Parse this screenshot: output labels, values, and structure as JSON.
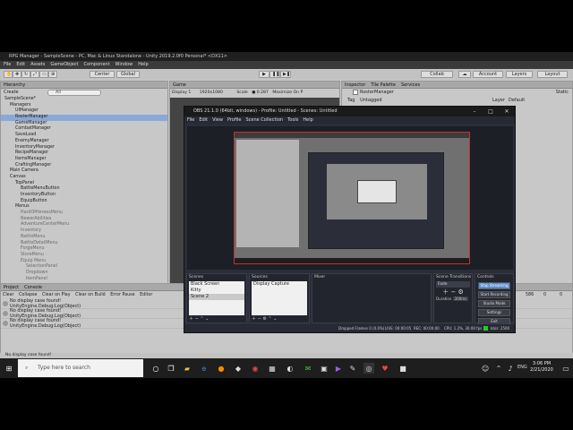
{
  "unity": {
    "title": "RPG Manager - SampleScene - PC, Mac & Linux Standalone - Unity 2019.2.0f0 Personal* <DX11>",
    "menu": [
      "File",
      "Edit",
      "Assets",
      "GameObject",
      "Component",
      "Window",
      "Help"
    ],
    "toolbar": {
      "pivot": "Center",
      "space": "Global",
      "collab": "Collab",
      "account": "Account",
      "layers": "Layers",
      "layout": "Layout"
    },
    "hierarchy_tab": "Hierarchy",
    "hierarchy_create": "Create",
    "hierarchy_search": "All",
    "hierarchy": [
      {
        "label": "SampleScene*",
        "indent": 0,
        "sel": false,
        "dim": false
      },
      {
        "label": "Managers",
        "indent": 1,
        "sel": false,
        "dim": false
      },
      {
        "label": "UIManager",
        "indent": 2,
        "sel": false,
        "dim": false
      },
      {
        "label": "RosterManager",
        "indent": 2,
        "sel": true,
        "dim": false
      },
      {
        "label": "GameManager",
        "indent": 2,
        "sel": false,
        "dim": false
      },
      {
        "label": "CombatManager",
        "indent": 2,
        "sel": false,
        "dim": false
      },
      {
        "label": "SaveLoad",
        "indent": 2,
        "sel": false,
        "dim": false
      },
      {
        "label": "EnemyManager",
        "indent": 2,
        "sel": false,
        "dim": false
      },
      {
        "label": "InventoryManager",
        "indent": 2,
        "sel": false,
        "dim": false
      },
      {
        "label": "RecipeManager",
        "indent": 2,
        "sel": false,
        "dim": false
      },
      {
        "label": "ItemsManager",
        "indent": 2,
        "sel": false,
        "dim": false
      },
      {
        "label": "CraftingManager",
        "indent": 2,
        "sel": false,
        "dim": false
      },
      {
        "label": "Main Camera",
        "indent": 1,
        "sel": false,
        "dim": false
      },
      {
        "label": "Canvas",
        "indent": 1,
        "sel": false,
        "dim": false
      },
      {
        "label": "TopPanel",
        "indent": 2,
        "sel": false,
        "dim": false
      },
      {
        "label": "BattleMenuButton",
        "indent": 3,
        "sel": false,
        "dim": false
      },
      {
        "label": "InventoryButton",
        "indent": 3,
        "sel": false,
        "dim": false
      },
      {
        "label": "EquipButton",
        "indent": 3,
        "sel": false,
        "dim": false
      },
      {
        "label": "Menus",
        "indent": 2,
        "sel": false,
        "dim": false
      },
      {
        "label": "HardOfHeroesMenu",
        "indent": 3,
        "sel": false,
        "dim": true
      },
      {
        "label": "NewerAbilities",
        "indent": 3,
        "sel": false,
        "dim": true
      },
      {
        "label": "AdventureCenterMenu",
        "indent": 3,
        "sel": false,
        "dim": true
      },
      {
        "label": "Inventory",
        "indent": 3,
        "sel": false,
        "dim": true
      },
      {
        "label": "BattleMenu",
        "indent": 3,
        "sel": false,
        "dim": true
      },
      {
        "label": "BattleDetailMenu",
        "indent": 3,
        "sel": false,
        "dim": true
      },
      {
        "label": "ForgeMenu",
        "indent": 3,
        "sel": false,
        "dim": true
      },
      {
        "label": "StoreMenu",
        "indent": 3,
        "sel": false,
        "dim": true
      },
      {
        "label": "Equip Menu",
        "indent": 3,
        "sel": false,
        "dim": true
      },
      {
        "label": "SelectionPanel",
        "indent": 4,
        "sel": false,
        "dim": true
      },
      {
        "label": "Dropdown",
        "indent": 4,
        "sel": false,
        "dim": true
      },
      {
        "label": "ItemPanel",
        "indent": 4,
        "sel": false,
        "dim": true
      }
    ],
    "game_tab": "Game",
    "game_display": "Display 1",
    "game_resolution": "1920x1080",
    "game_scale_label": "Scale",
    "game_scale_value": "0.287",
    "game_maximize": "Maximize On P",
    "inspector_tabs": [
      "Inspector",
      "Tile Palette",
      "Services"
    ],
    "inspector_object": "RosterManager",
    "inspector_static": "Static",
    "inspector_tag_label": "Tag",
    "inspector_tag": "Untagged",
    "inspector_layer_label": "Layer",
    "inspector_layer": "Default",
    "bottom_tabs": [
      "Project",
      "Console"
    ],
    "console_buttons": [
      "Clear",
      "Collapse",
      "Clear on Play",
      "Clear on Build",
      "Error Pause",
      "Editor"
    ],
    "console_counts": [
      "586",
      "0",
      "0"
    ],
    "console_rows": [
      {
        "line1": "No display case found!",
        "line2": "UnityEngine.Debug:Log(Object)"
      },
      {
        "line1": "No display case found!",
        "line2": "UnityEngine.Debug:Log(Object)"
      },
      {
        "line1": "No display case found!",
        "line2": "UnityEngine.Debug:Log(Object)"
      }
    ],
    "status": "No display case found!"
  },
  "obs": {
    "title": "OBS 21.1.0 (64bit, windows) - Profile: Untitled - Scenes: Untitled",
    "menu": [
      "File",
      "Edit",
      "View",
      "Profile",
      "Scene Collection",
      "Tools",
      "Help"
    ],
    "docks": {
      "scenes": {
        "title": "Scenes",
        "items": [
          "Black Screen",
          "Kitty",
          "Scene 2"
        ],
        "selected": 2
      },
      "sources": {
        "title": "Sources",
        "items": [
          "Display Capture"
        ]
      },
      "mixer": {
        "title": "Mixer"
      },
      "transitions": {
        "title": "Scene Transitions",
        "type": "Fade",
        "duration_label": "Duration",
        "duration": "300ms"
      },
      "controls": {
        "title": "Controls",
        "buttons": [
          "Stop Streaming",
          "Start Recording",
          "Studio Mode",
          "Settings",
          "Exit"
        ]
      }
    },
    "status": {
      "dropped": "Dropped Frames 0 (0.0%)",
      "live": "LIVE: 00:00:05",
      "rec": "REC: 00:00:00",
      "cpu": "CPU: 1.2%, 30.00 fps",
      "kbps": "kb/s: 2500"
    },
    "accent": "#5b8fd0"
  },
  "taskbar": {
    "search_placeholder": "Type here to search",
    "time": "3:06 PM",
    "date": "2/21/2020",
    "lang": "ENG"
  },
  "colors": {
    "unity_panel": "#c8c8c8",
    "unity_selection": "#8aa9d6",
    "obs_bg": "#2b2e38",
    "taskbar": "#1e1e1e"
  }
}
